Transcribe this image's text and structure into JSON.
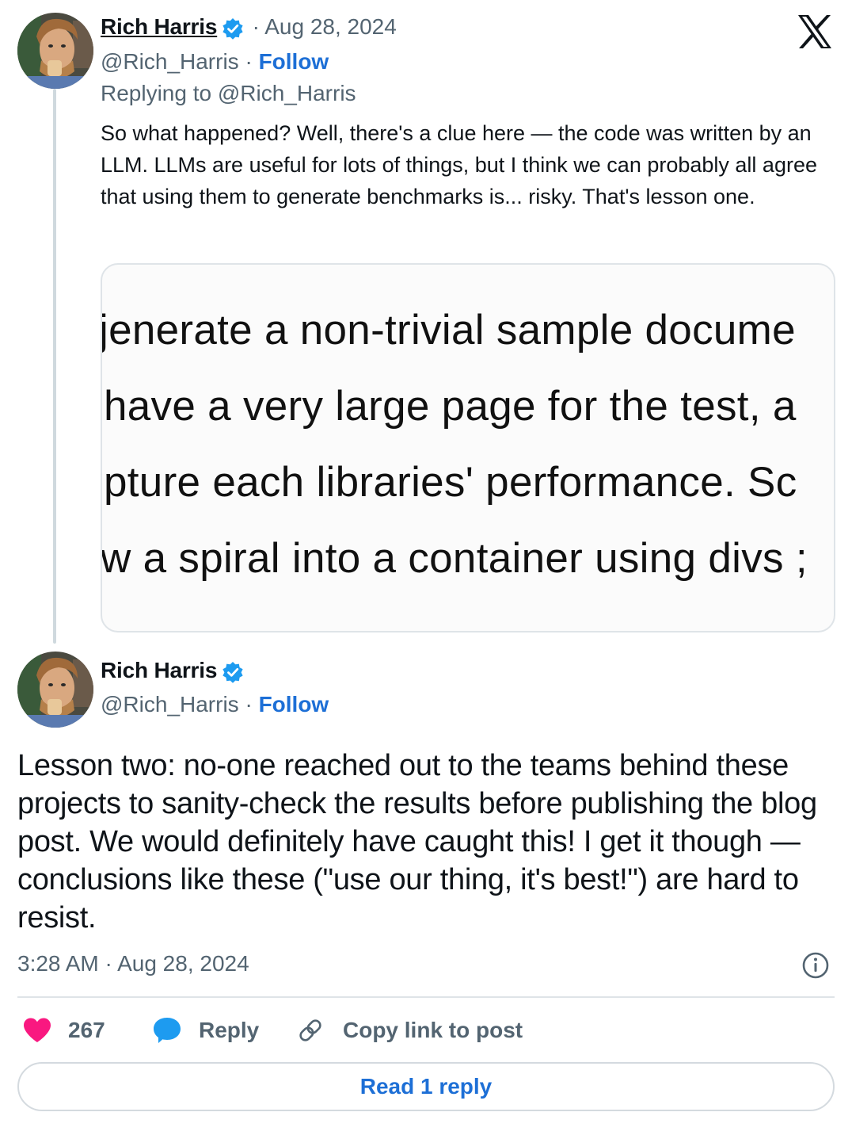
{
  "brand": {
    "logo_icon": "x-logo-icon"
  },
  "reply_tweet": {
    "author_name": "Rich Harris",
    "verified_icon": "verified-badge-icon",
    "date": "· Aug 28, 2024",
    "handle": "@Rich_Harris",
    "separator": "·",
    "follow_label": "Follow",
    "replying_to": "Replying to @Rich_Harris",
    "text": "So what happened? Well, there's a clue here — the code was written by an LLM. LLMs are useful for lots of things, but I think we can probably all agree that using them to generate benchmarks is... risky. That's lesson one.",
    "media_lines": [
      "jenerate a non-trivial sample docume",
      "have a very large page for the test, a",
      "pture each libraries' performance. Sc",
      "w a spiral into a container using divs ;"
    ]
  },
  "main_tweet": {
    "author_name": "Rich Harris",
    "verified_icon": "verified-badge-icon",
    "handle": "@Rich_Harris",
    "separator": "·",
    "follow_label": "Follow",
    "text": "Lesson two: no-one reached out to the teams behind these projects to sanity-check the results before publishing the blog post. We would definitely have caught this! I get it though — conclusions like these (\"use our thing, it's best!\") are hard to resist.",
    "timestamp": "3:28 AM · Aug 28, 2024",
    "info_icon": "info-icon"
  },
  "actions": {
    "like_count": "267",
    "like_icon": "heart-icon",
    "reply_label": "Reply",
    "reply_icon": "speech-bubble-icon",
    "copy_label": "Copy link to post",
    "copy_icon": "link-icon"
  },
  "read_replies_label": "Read 1 reply",
  "colors": {
    "accent": "#1d6fd6",
    "verified": "#1d9bf0",
    "like": "#f91880",
    "secondary_text": "#536471"
  }
}
